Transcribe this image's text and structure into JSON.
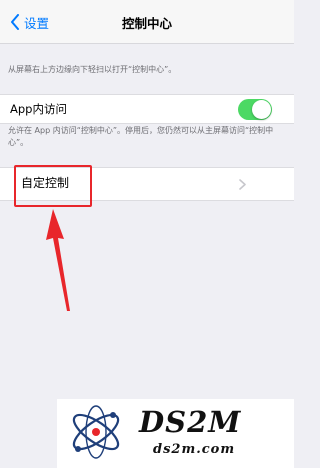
{
  "nav": {
    "back_label": "设置",
    "title": "控制中心"
  },
  "descriptions": {
    "top": "从屏幕右上方边缘向下轻扫以打开“控制中心”。",
    "access": "允许在 App 内访问“控制中心”。停用后，您仍然可以从主屏幕访问“控制中心”。"
  },
  "settings": {
    "app_access_label": "App内访问",
    "app_access_enabled": true,
    "customize_label": "自定控制"
  },
  "colors": {
    "accent": "#007aff",
    "toggle_on": "#4cd964",
    "annotation_red": "#e8262b"
  },
  "icons": {
    "back": "chevron-left-icon",
    "disclosure": "chevron-right-icon",
    "annotation": "arrow-up-icon"
  },
  "watermark": {
    "brand": "DS2M",
    "url": "ds2m.com"
  }
}
